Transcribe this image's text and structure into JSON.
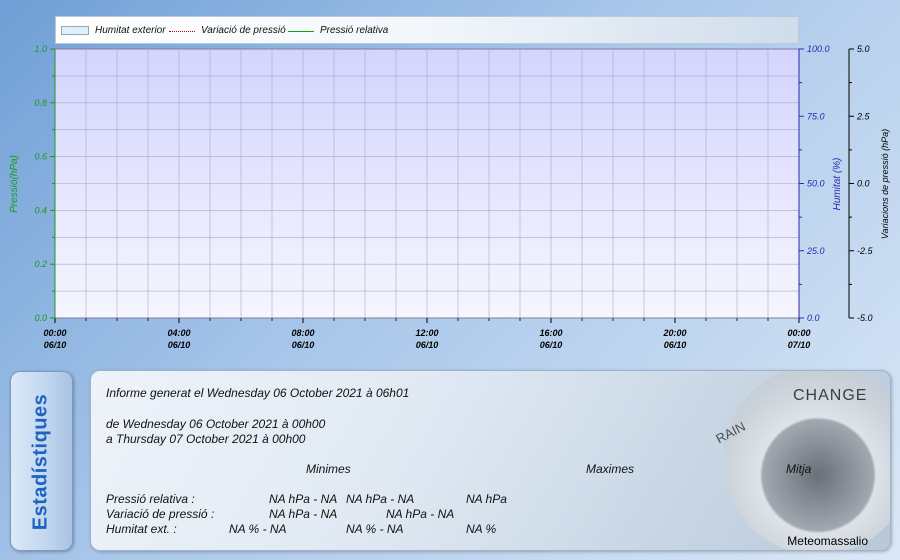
{
  "chart_data": {
    "type": "line",
    "x_ticks": [
      {
        "time": "00:00",
        "date": "06/10"
      },
      {
        "time": "04:00",
        "date": "06/10"
      },
      {
        "time": "08:00",
        "date": "06/10"
      },
      {
        "time": "12:00",
        "date": "06/10"
      },
      {
        "time": "16:00",
        "date": "06/10"
      },
      {
        "time": "20:00",
        "date": "06/10"
      },
      {
        "time": "00:00",
        "date": "07/10"
      }
    ],
    "x_range": [
      "06/10 00:00",
      "07/10 00:00"
    ],
    "y_left": {
      "label": "Pressió(hPa)",
      "range": [
        0.0,
        1.0
      ],
      "ticks": [
        "0.0",
        "0.2",
        "0.4",
        "0.6",
        "0.8",
        "1.0"
      ],
      "color": "#1b9a1b"
    },
    "y_right": {
      "label": "Humitat (%)",
      "range": [
        0.0,
        100.0
      ],
      "ticks": [
        "0.0",
        "25.0",
        "50.0",
        "75.0",
        "100.0"
      ],
      "color": "#2a2ab0"
    },
    "y_far_right": {
      "label": "Variacions de pressió (hPa)",
      "range": [
        -5.0,
        5.0
      ],
      "ticks": [
        "-5.0",
        "-2.5",
        "0.0",
        "2.5",
        "5.0"
      ],
      "color": "#000000"
    },
    "series": [
      {
        "name": "Humitat exterior",
        "kind": "area",
        "color": "#d9d9ff",
        "values": []
      },
      {
        "name": "Variació de pressió",
        "kind": "dotted-line",
        "color": "#d00000",
        "values": []
      },
      {
        "name": "Pressió relativa",
        "kind": "line",
        "color": "#1b9a1b",
        "values": []
      }
    ],
    "grid": true,
    "legend_position": "top"
  },
  "stats": {
    "tab_label": "Estadístiques",
    "report_line": "Informe generat el Wednesday 06 October 2021 à 06h01",
    "from_line": "de Wednesday 06 October 2021 à 00h00",
    "to_line": "a Thursday 07 October 2021 à 00h00",
    "col_min": "Minimes",
    "col_max": "Maximes",
    "col_avg": "Mitja",
    "rows": [
      {
        "label": "Pressió relativa :",
        "min": "NA hPa - NA",
        "max": "NA hPa - NA",
        "avg": "NA hPa"
      },
      {
        "label": "Variació de pressió :",
        "min": "NA hPa - NA",
        "max": "NA hPa - NA",
        "avg": ""
      },
      {
        "label": "Humitat ext. :",
        "min": "NA % - NA",
        "max": "NA % - NA",
        "avg": "NA %"
      }
    ],
    "credit": "Meteomassalio",
    "barometer_text": {
      "change": "CHANGE",
      "rain": "RAIN"
    }
  }
}
